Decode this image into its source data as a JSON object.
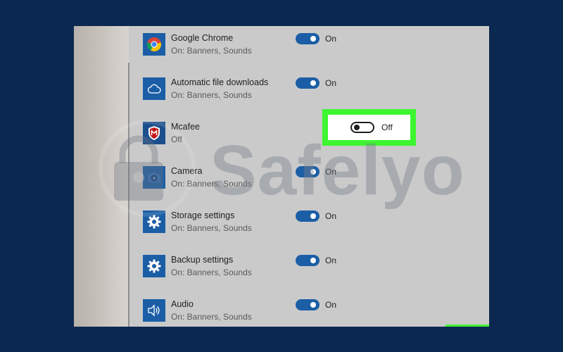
{
  "rows": [
    {
      "name": "Google Chrome",
      "sub": "On: Banners, Sounds",
      "icon": "chrome-icon",
      "state": "On"
    },
    {
      "name": "Automatic file downloads",
      "sub": "On: Banners, Sounds",
      "icon": "cloud-icon",
      "state": "On"
    },
    {
      "name": "Mcafee",
      "sub": "Off",
      "icon": "mcafee-shield-icon",
      "state": "Off"
    },
    {
      "name": "Camera",
      "sub": "On: Banners, Sounds",
      "icon": "camera-icon",
      "state": "On"
    },
    {
      "name": "Storage settings",
      "sub": "On: Banners, Sounds",
      "icon": "gear-icon",
      "state": "On"
    },
    {
      "name": "Backup settings",
      "sub": "On: Banners, Sounds",
      "icon": "gear-icon",
      "state": "On"
    },
    {
      "name": "Audio",
      "sub": "On: Banners, Sounds",
      "icon": "speaker-icon",
      "state": "On"
    }
  ],
  "watermark": {
    "text": "Safelyo"
  },
  "colors": {
    "background": "#0b2850",
    "accent": "#1b5ea6",
    "highlight": "#3ef531",
    "panel": "#cacaca"
  }
}
